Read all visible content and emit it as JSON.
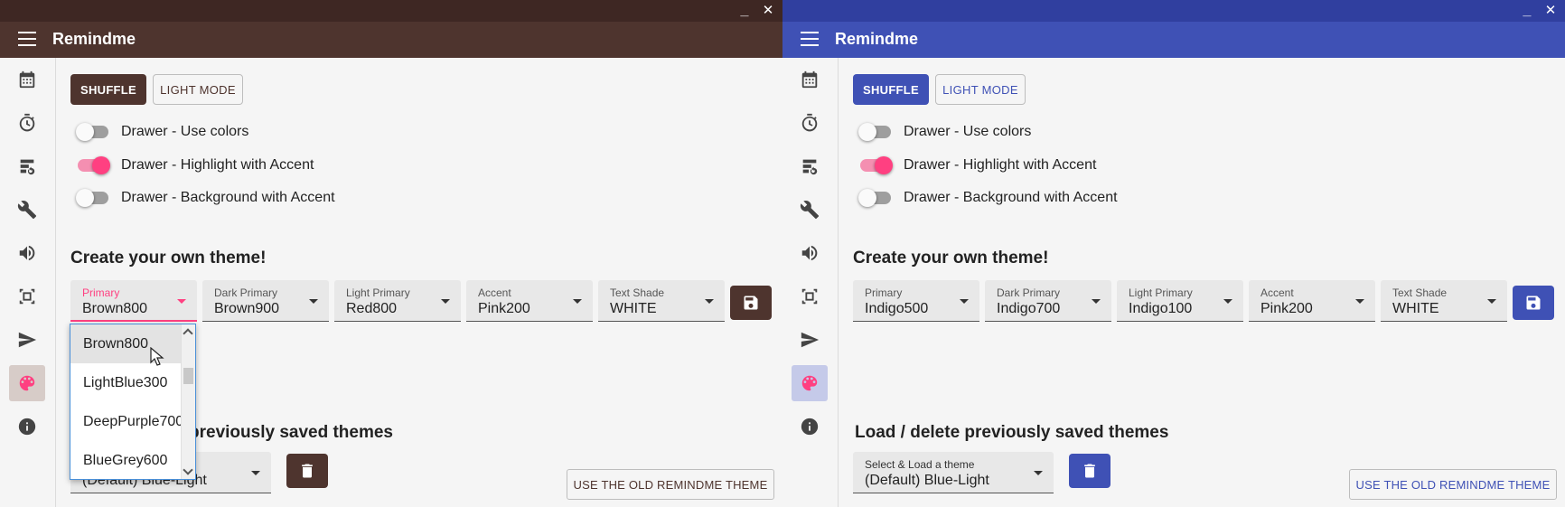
{
  "app": {
    "title": "Remindme"
  },
  "window_controls": {
    "minimize": "_",
    "close": "✕"
  },
  "nav": [
    {
      "icon": "calendar-icon"
    },
    {
      "icon": "timer-icon"
    },
    {
      "icon": "database-refresh-icon"
    },
    {
      "icon": "wrench-icon"
    },
    {
      "icon": "volume-icon"
    },
    {
      "icon": "image-frame-icon"
    },
    {
      "icon": "send-icon"
    },
    {
      "icon": "palette-icon",
      "selected": true
    },
    {
      "icon": "info-icon"
    }
  ],
  "actions": {
    "shuffle": "SHUFFLE",
    "light_mode": "LIGHT MODE"
  },
  "toggles": [
    {
      "label": "Drawer - Use colors",
      "on": false
    },
    {
      "label": "Drawer - Highlight with Accent",
      "on": true
    },
    {
      "label": "Drawer - Background with Accent",
      "on": false
    }
  ],
  "create_title": "Create your own theme!",
  "field_labels": {
    "primary": "Primary",
    "dark_primary": "Dark Primary",
    "light_primary": "Light Primary",
    "accent": "Accent",
    "text_shade": "Text Shade"
  },
  "brown_theme": {
    "primary": "Brown800",
    "dark_primary": "Brown900",
    "light_primary": "Red800",
    "accent": "Pink200",
    "text_shade": "WHITE",
    "colors": {
      "primary": "#4e342e",
      "dark": "#3e2723",
      "light": "#d7ccc8"
    }
  },
  "indigo_theme": {
    "primary": "Indigo500",
    "dark_primary": "Indigo700",
    "light_primary": "Indigo100",
    "accent": "Pink200",
    "text_shade": "WHITE",
    "colors": {
      "primary": "#3f51b5",
      "dark": "#303f9f",
      "light": "#c5cae9"
    }
  },
  "accent_color": "#ff4081",
  "primary_dropdown_options": [
    "Brown800",
    "LightBlue300",
    "DeepPurple700",
    "BlueGrey600"
  ],
  "load_section": {
    "title": "Load / delete previously saved themes",
    "title_visible_part": "previously saved themes",
    "select_label": "Select & Load a theme",
    "select_value": "(Default) Blue-Light"
  },
  "old_theme_button": "USE THE OLD REMINDME THEME"
}
